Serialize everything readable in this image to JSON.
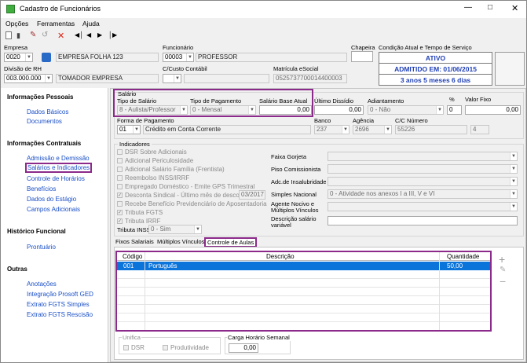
{
  "window": {
    "title": "Cadastro de Funcionários"
  },
  "menu": [
    "Opções",
    "Ferramentas",
    "Ajuda"
  ],
  "header": {
    "empresa_label": "Empresa",
    "empresa_code": "0020",
    "empresa_name": "EMPRESA FOLHA 123",
    "funcionario_label": "Funcionário",
    "funcionario_code": "00003",
    "funcionario_name": "PROFESSOR",
    "chapeira_label": "Chapeira",
    "condicao_label": "Condição Atual e Tempo de Serviço",
    "status": "ATIVO",
    "admitido": "ADMITIDO EM: 01/06/2015",
    "tempo": "3 anos 5 meses 6 dias",
    "divisao_label": "Divisão de RH",
    "divisao_code": "003.000.000",
    "divisao_name": "TOMADOR EMPRESA",
    "ccusto_label": "C/Custo Contábil",
    "matricula_label": "Matrícula eSocial",
    "matricula_value": "0525737700014400003"
  },
  "sidebar": {
    "sections": [
      {
        "title": "Informações Pessoais",
        "items": [
          "Dados Básicos",
          "Documentos"
        ]
      },
      {
        "title": "Informações Contratuais",
        "items": [
          "Admissão e Demissão",
          "Salários e Indicadores",
          "Controle de Horários",
          "Benefícios",
          "Dados do Estágio",
          "Campos Adicionais"
        ]
      },
      {
        "title": "Histórico Funcional",
        "items": [
          "Prontuário"
        ]
      },
      {
        "title": "Outras",
        "items": [
          "Anotações",
          "Integração Prosoft GED",
          "Extrato FGTS Simples",
          "Extrato FGTS Rescisão"
        ]
      }
    ]
  },
  "salario": {
    "group": "Salário",
    "tipo_label": "Tipo de Salário",
    "tipo_value": "8 - Aulista/Professor",
    "tipo_pag_label": "Tipo de Pagamento",
    "tipo_pag_value": "0 - Mensal",
    "base_label": "Salário Base Atual",
    "base_value": "0,00",
    "ultimo_label": "Último Dissídio",
    "ultimo_value": "0,00",
    "adiant_label": "Adiantamento",
    "adiant_value": "0 - Não",
    "pct_label": "%",
    "pct_value": "0",
    "valor_fixo_label": "Valor Fixo",
    "valor_fixo_value": "0,00",
    "forma_label": "Forma de Pagamento",
    "forma_code": "01",
    "forma_value": "Crédito em Conta Corrente",
    "banco_label": "Banco",
    "banco_value": "237",
    "agencia_label": "Agência",
    "agencia_value": "2696",
    "conta_label": "C/C Número",
    "conta_value": "55226",
    "conta_dv": "4"
  },
  "indicadores": {
    "group": "Indicadores",
    "checks": [
      {
        "label": "DSR Sobre Adicionais",
        "checked": false
      },
      {
        "label": "Adicional Periculosidade",
        "checked": false
      },
      {
        "label": "Adicional Salário Família (Frentista)",
        "checked": false
      },
      {
        "label": "Reembolso INSS/IRRF",
        "checked": false
      },
      {
        "label": "Empregado Doméstico - Emite GPS Trimestral",
        "checked": false
      },
      {
        "label": "Desconta Sindical - Último mês de desconto",
        "checked": true
      },
      {
        "label": "Recebe Benefício Previdenciário de Aposentadoria",
        "checked": false
      },
      {
        "label": "Tributa FGTS",
        "checked": true
      },
      {
        "label": "Tributa IRRF",
        "checked": true
      }
    ],
    "sindical_mes": "03/2017",
    "tributa_inss_label": "Tributa INSS",
    "tributa_inss_value": "0 - Sim",
    "right_labels": [
      "Faixa Gorjeta",
      "Piso Comissionista",
      "Adc.de Insalubridade",
      "Simples Nacional",
      "Agente Nocivo e Múltiplos Vínculos",
      "Descrição salário variável"
    ],
    "simples_value": "0 - Atividade nos anexos I a III, V e VI"
  },
  "tabs": [
    "Fixos Salariais",
    "Múltiplos Vínculos",
    "Controle de Aulas"
  ],
  "aulas": {
    "headers": [
      "Código",
      "Descrição",
      "Quantidade"
    ],
    "rows": [
      {
        "codigo": "001",
        "descricao": "Português",
        "quantidade": "50,00"
      }
    ]
  },
  "unifica": {
    "label": "Unifica",
    "dsr": "DSR",
    "produtividade": "Produtividade"
  },
  "carga": {
    "label": "Carga Horário Semanal",
    "value": "0,00"
  }
}
